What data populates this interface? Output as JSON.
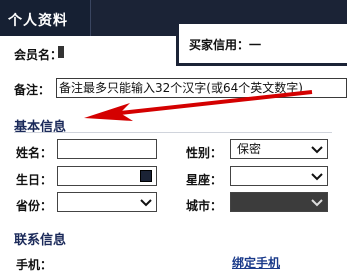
{
  "header": {
    "title": "个人资料"
  },
  "popup": {
    "buyer_credit": "买家信用：一"
  },
  "member": {
    "name_label": "会员名："
  },
  "remark": {
    "label": "备注：",
    "value": "备注最多只能输入32个汉字(或64个英文数字)"
  },
  "basic_info": {
    "title": "基本信息",
    "name_label": "姓名：",
    "gender_label": "性别：",
    "gender_value": "保密",
    "birthday_label": "生日：",
    "constellation_label": "星座：",
    "province_label": "省份：",
    "city_label": "城市："
  },
  "contact_info": {
    "title": "联系信息",
    "phone_label": "手机：",
    "bind_phone": "绑定手机"
  },
  "colors": {
    "header_bg": "#1b2336",
    "arrow": "#d40000",
    "link": "#1a3a8a"
  },
  "icons": {
    "dropdown": "chevron-down-icon",
    "calendar": "calendar-icon"
  }
}
